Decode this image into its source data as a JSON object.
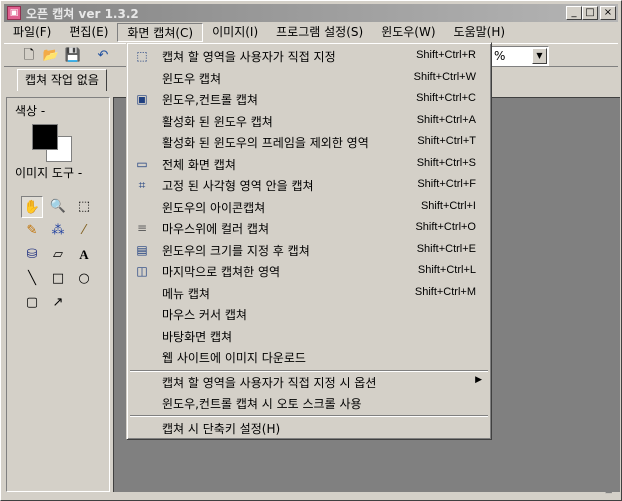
{
  "window": {
    "title": "오픈 캡쳐 ver 1.3.2"
  },
  "title_controls": {
    "minimize": "_",
    "maximize": "□",
    "close": "×"
  },
  "menubar": [
    {
      "label": "파일(F)"
    },
    {
      "label": "편집(E)"
    },
    {
      "label": "화면 캡쳐(C)"
    },
    {
      "label": "이미지(I)"
    },
    {
      "label": "프로그램 설정(S)"
    },
    {
      "label": "윈도우(W)"
    },
    {
      "label": "도움말(H)"
    }
  ],
  "toolbar": {
    "zoom_value": "%",
    "zoom_arrow": "▼"
  },
  "tab": {
    "label": "캡쳐 작업 없음"
  },
  "left_panel": {
    "color_label": "색상 -",
    "tools_label": "이미지 도구 -"
  },
  "tools": [
    {
      "icon": "hand-icon",
      "glyph": "✋"
    },
    {
      "icon": "magnifier-icon",
      "glyph": "🔍"
    },
    {
      "icon": "select-rect-icon",
      "glyph": "⬚"
    },
    {
      "icon": "pencil-icon",
      "glyph": "✎"
    },
    {
      "icon": "spray-icon",
      "glyph": "⁂"
    },
    {
      "icon": "dropper-icon",
      "glyph": "⁄"
    },
    {
      "icon": "fill-bucket-icon",
      "glyph": "⛁"
    },
    {
      "icon": "eraser-icon",
      "glyph": "▱"
    },
    {
      "icon": "text-icon",
      "glyph": "A"
    },
    {
      "icon": "line-icon",
      "glyph": "╲"
    },
    {
      "icon": "rectangle-icon",
      "glyph": "□"
    },
    {
      "icon": "ellipse-icon",
      "glyph": "○"
    },
    {
      "icon": "rounded-rect-icon",
      "glyph": "▢"
    },
    {
      "icon": "arrow-icon",
      "glyph": "↗"
    }
  ],
  "dropdown": {
    "groups": [
      [
        {
          "label": "캡쳐 할 영역을 사용자가 직접 지정",
          "shortcut": "Shift+Ctrl+R",
          "icon": "region-select-icon",
          "glyph": "⬚"
        },
        {
          "label": "윈도우 캡쳐",
          "shortcut": "Shift+Ctrl+W",
          "icon": "",
          "glyph": ""
        },
        {
          "label": "윈도우,컨트롤 캡쳐",
          "shortcut": "Shift+Ctrl+C",
          "icon": "control-capture-icon",
          "glyph": "▣"
        },
        {
          "label": "활성화 된 윈도우 캡쳐",
          "shortcut": "Shift+Ctrl+A",
          "icon": "",
          "glyph": ""
        },
        {
          "label": "활성화 된 윈도우의 프레임을 제외한 영역",
          "shortcut": "Shift+Ctrl+T",
          "icon": "",
          "glyph": ""
        },
        {
          "label": "전체 화면 캡쳐",
          "shortcut": "Shift+Ctrl+S",
          "icon": "fullscreen-icon",
          "glyph": "▭"
        },
        {
          "label": "고정 된 사각형 영역 안을 캡쳐",
          "shortcut": "Shift+Ctrl+F",
          "icon": "fixed-rect-icon",
          "glyph": "⌗"
        },
        {
          "label": "윈도우의 아이콘캡쳐",
          "shortcut": "Shift+Ctrl+I",
          "icon": "",
          "glyph": ""
        },
        {
          "label": "마우스위에 컬러 캡쳐",
          "shortcut": "Shift+Ctrl+O",
          "icon": "color-pick-icon",
          "glyph": "≡"
        },
        {
          "label": "윈도우의 크기를 지정 후 캡쳐",
          "shortcut": "Shift+Ctrl+E",
          "icon": "resize-window-icon",
          "glyph": "▤"
        },
        {
          "label": "마지막으로 캡쳐한 영역",
          "shortcut": "Shift+Ctrl+L",
          "icon": "last-region-icon",
          "glyph": "◫"
        },
        {
          "label": "메뉴 캡쳐",
          "shortcut": "Shift+Ctrl+M",
          "icon": "",
          "glyph": ""
        },
        {
          "label": "마우스 커서 캡쳐",
          "shortcut": "",
          "icon": "",
          "glyph": ""
        },
        {
          "label": "바탕화면 캡쳐",
          "shortcut": "",
          "icon": "",
          "glyph": ""
        },
        {
          "label": "웹 사이트에 이미지 다운로드",
          "shortcut": "",
          "icon": "",
          "glyph": ""
        }
      ],
      [
        {
          "label": "캡쳐 할 영역을 사용자가 직접 지정 시 옵션",
          "shortcut": "",
          "submenu": "▶",
          "icon": "",
          "glyph": ""
        },
        {
          "label": "윈도우,컨트롤 캡쳐 시 오토 스크롤 사용",
          "shortcut": "",
          "icon": "",
          "glyph": ""
        }
      ],
      [
        {
          "label": "캡쳐 시 단축키 설정(H)",
          "shortcut": "",
          "icon": "",
          "glyph": ""
        }
      ]
    ]
  }
}
